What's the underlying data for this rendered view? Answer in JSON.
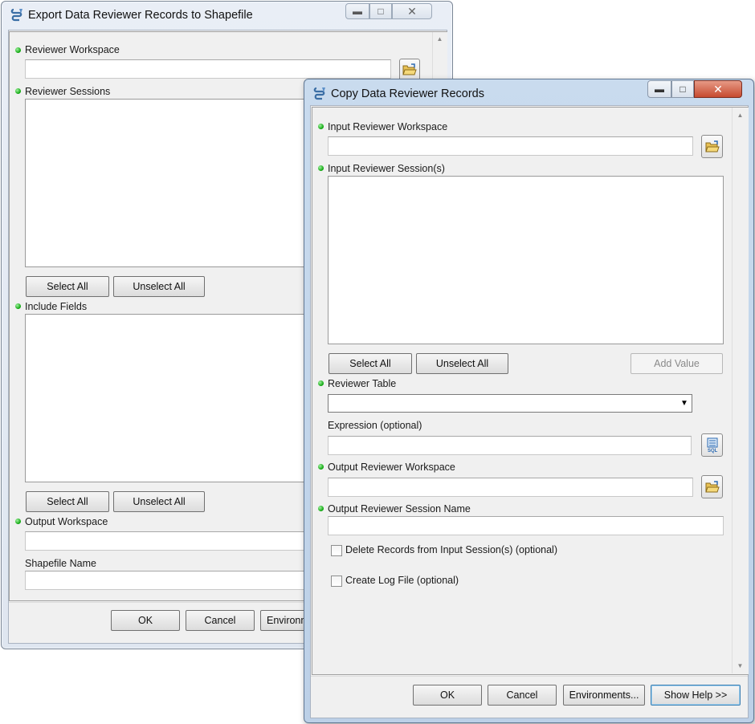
{
  "colors": {
    "required_dot": "#0aa30a",
    "title_bar_active": "#bcd0e7",
    "title_bar_inactive": "#dfe6f0",
    "client_bg": "#f0f0f0",
    "close_button": "#c64a2f"
  },
  "back_window": {
    "title": "Export Data Reviewer Records to Shapefile",
    "icon": "geoprocessing-tool-icon",
    "params": {
      "reviewer_workspace": {
        "label": "Reviewer Workspace",
        "value": ""
      },
      "reviewer_sessions": {
        "label": "Reviewer Sessions"
      },
      "include_fields": {
        "label": "Include Fields"
      },
      "output_workspace": {
        "label": "Output Workspace",
        "value": ""
      },
      "shapefile_name": {
        "label": "Shapefile Name",
        "value": ""
      }
    },
    "buttons": {
      "select_all_1": "Select All",
      "unselect_all_1": "Unselect All",
      "select_all_2": "Select All",
      "unselect_all_2": "Unselect All",
      "ok": "OK",
      "cancel": "Cancel",
      "environments": "Environments..."
    }
  },
  "front_window": {
    "title": "Copy Data Reviewer Records",
    "icon": "geoprocessing-tool-icon",
    "params": {
      "input_workspace": {
        "label": "Input Reviewer Workspace",
        "value": ""
      },
      "input_sessions": {
        "label": "Input Reviewer Session(s)"
      },
      "reviewer_table": {
        "label": "Reviewer Table",
        "value": ""
      },
      "expression": {
        "label": "Expression (optional)",
        "value": ""
      },
      "output_workspace": {
        "label": "Output Reviewer Workspace",
        "value": ""
      },
      "output_session_name": {
        "label": "Output Reviewer Session Name",
        "value": ""
      }
    },
    "checkboxes": {
      "delete_records": {
        "label": "Delete Records from Input Session(s) (optional)",
        "checked": false
      },
      "create_log": {
        "label": "Create Log File (optional)",
        "checked": false
      }
    },
    "buttons": {
      "select_all": "Select All",
      "unselect_all": "Unselect All",
      "add_value": "Add Value",
      "ok": "OK",
      "cancel": "Cancel",
      "environments": "Environments...",
      "show_help": "Show Help >>"
    },
    "sql_icon_text": "SQL"
  },
  "window_controls": {
    "minimize": "minimize-icon",
    "maximize": "maximize-icon",
    "close": "close-icon"
  }
}
